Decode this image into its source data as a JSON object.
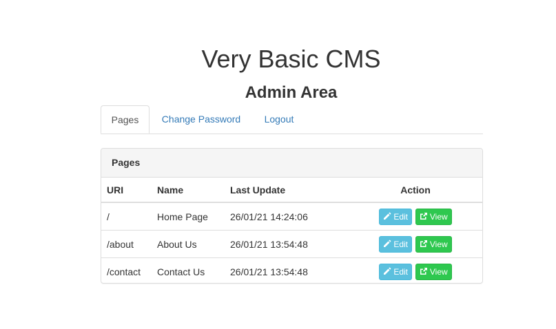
{
  "header": {
    "title": "Very Basic CMS",
    "subtitle": "Admin Area"
  },
  "tabs": [
    {
      "label": "Pages",
      "active": true
    },
    {
      "label": "Change Password",
      "active": false
    },
    {
      "label": "Logout",
      "active": false
    }
  ],
  "panel": {
    "heading": "Pages",
    "columns": [
      "URI",
      "Name",
      "Last Update",
      "Action"
    ],
    "rows": [
      {
        "uri": "/",
        "name": "Home Page",
        "last_update": "26/01/21 14:24:06"
      },
      {
        "uri": "/about",
        "name": "About Us",
        "last_update": "26/01/21 13:54:48"
      },
      {
        "uri": "/contact",
        "name": "Contact Us",
        "last_update": "26/01/21 13:54:48"
      }
    ],
    "edit_label": "Edit",
    "view_label": "View",
    "edit_icon": "pencil-icon",
    "view_icon": "external-link-icon"
  },
  "colors": {
    "link": "#337ab7",
    "edit_button": "#5bc0de",
    "view_button": "#2ec84f"
  }
}
